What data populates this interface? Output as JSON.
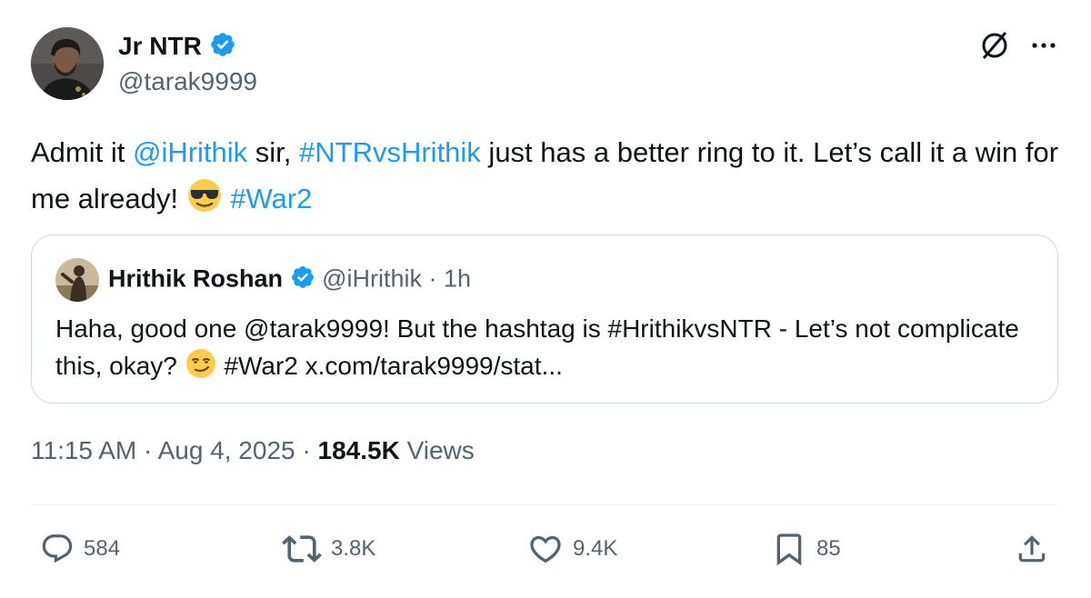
{
  "author": {
    "name": "Jr NTR",
    "handle": "@tarak9999",
    "verified": true
  },
  "tweet": {
    "text_parts": [
      {
        "text": "Admit it ",
        "type": "text"
      },
      {
        "text": "@iHrithik",
        "type": "mention"
      },
      {
        "text": " sir, ",
        "type": "text"
      },
      {
        "text": "#NTRvsHrithik",
        "type": "hashtag"
      },
      {
        "text": " just has a better ring to it. Let’s call it a win for me already! ",
        "type": "text"
      },
      {
        "text": "#War2",
        "type": "hashtag"
      }
    ],
    "emoji": "sunglasses-face"
  },
  "quote": {
    "name": "Hrithik Roshan",
    "handle": "@iHrithik",
    "separator": "·",
    "time": "1h",
    "verified": true,
    "text_before_emoji": "Haha, good one @tarak9999! But the hashtag is #HrithikvsNTR - Let’s not complicate this, okay?",
    "emoji": "smirking-face",
    "text_after_emoji": "#War2 x.com/tarak9999/stat..."
  },
  "meta": {
    "time": "11:15 AM",
    "separator": "·",
    "date": "Aug 4, 2025",
    "views_count": "184.5K",
    "views_label": "Views"
  },
  "actions": {
    "replies": "584",
    "reposts": "3.8K",
    "likes": "9.4K",
    "bookmarks": "85"
  },
  "colors": {
    "accent": "#1d9bf0",
    "text": "#0f1419",
    "secondary": "#536471",
    "border": "#cfd9de"
  }
}
